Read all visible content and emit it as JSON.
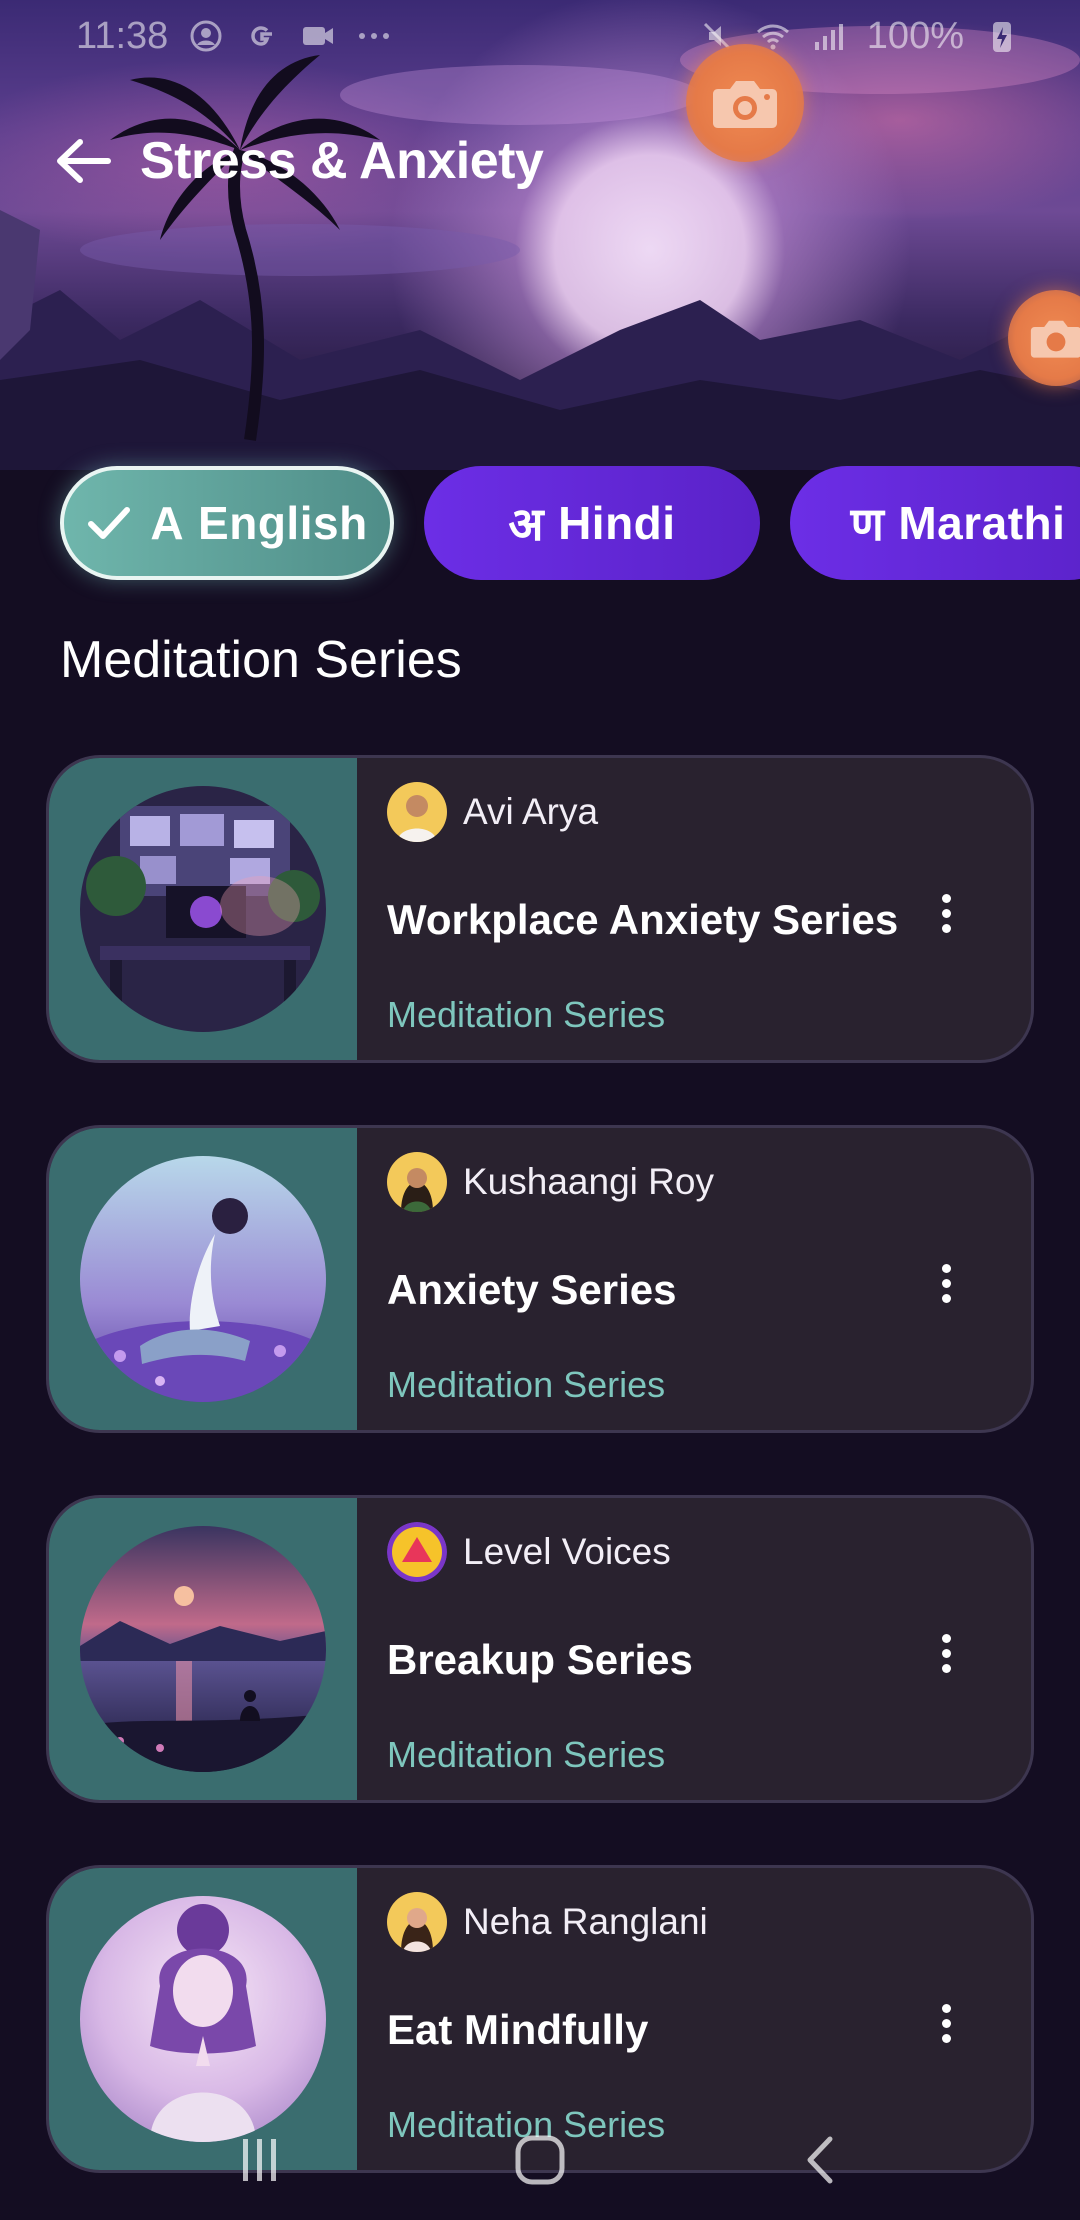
{
  "status_bar": {
    "time": "11:38",
    "battery": "100%",
    "icons": [
      "account-circle-icon",
      "google-g-icon",
      "video-camera-icon",
      "more-dots-icon",
      "mute-icon",
      "wifi-icon",
      "signal-icon",
      "battery-charging-icon"
    ]
  },
  "header": {
    "title": "Stress & Anxiety",
    "back_icon": "arrow-left-icon"
  },
  "languages": [
    {
      "glyph": "A",
      "label": "English",
      "selected": true
    },
    {
      "glyph": "अ",
      "label": "Hindi",
      "selected": false
    },
    {
      "glyph": "ण",
      "label": "Marathi",
      "selected": false
    }
  ],
  "section": {
    "title": "Meditation Series"
  },
  "cards": [
    {
      "author": "Avi Arya",
      "title": "Workplace Anxiety Series",
      "type": "Meditation Series"
    },
    {
      "author": "Kushaangi Roy",
      "title": "Anxiety Series",
      "type": "Meditation Series"
    },
    {
      "author": "Level Voices",
      "title": "Breakup Series",
      "type": "Meditation Series"
    },
    {
      "author": "Neha Ranglani",
      "title": "Eat Mindfully",
      "type": "Meditation Series"
    }
  ],
  "colors": {
    "background": "#140d22",
    "card": "#29222f",
    "thumb_panel": "#3a6d6f",
    "accent_teal": "#7ec6bd",
    "chip_purple": "#6c2ee6",
    "chip_active": "#6fb6ac",
    "camera_bubble": "#e57a48"
  }
}
